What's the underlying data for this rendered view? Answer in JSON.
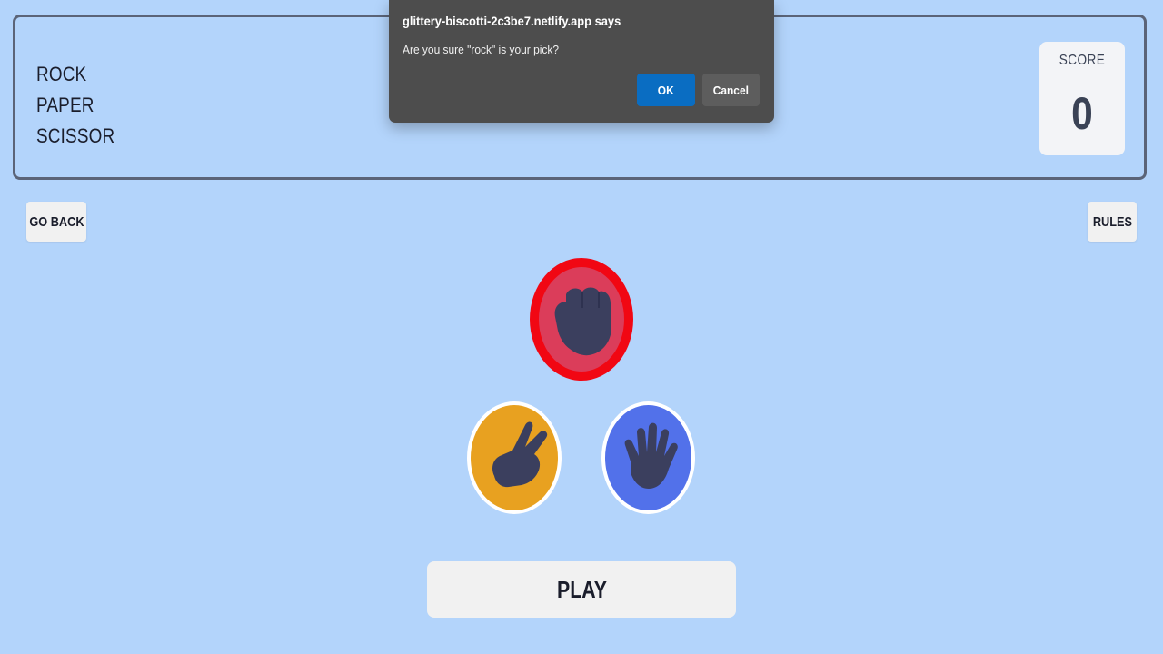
{
  "header": {
    "title_lines": [
      "ROCK",
      "PAPER",
      "SCISSOR"
    ],
    "score_label": "SCORE",
    "score_value": "0"
  },
  "nav": {
    "go_back_label": "GO BACK",
    "rules_label": "RULES"
  },
  "choices": {
    "rock": {
      "color": "#db3d5a",
      "border": "#f10713",
      "icon": "fist-icon"
    },
    "scissor": {
      "color": "#e8a120",
      "border": "#ffffff",
      "icon": "peace-hand-icon"
    },
    "paper": {
      "color": "#5271ea",
      "border": "#ffffff",
      "icon": "open-hand-icon"
    }
  },
  "play_label": "PLAY",
  "dialog": {
    "title": "glittery-biscotti-2c3be7.netlify.app says",
    "message": "Are you sure \"rock\" is your pick?",
    "ok_label": "OK",
    "cancel_label": "Cancel"
  }
}
